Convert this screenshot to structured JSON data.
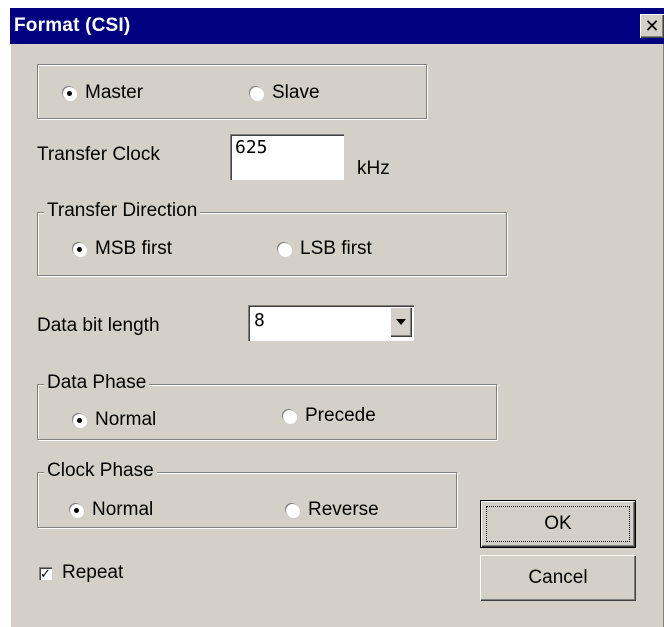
{
  "window": {
    "title": "Format (CSI)",
    "close_glyph": "✕"
  },
  "mode": {
    "master_label": "Master",
    "slave_label": "Slave",
    "selected": "Master"
  },
  "transfer_clock": {
    "label": "Transfer Clock",
    "value": "625",
    "unit": "kHz"
  },
  "transfer_direction": {
    "legend": "Transfer Direction",
    "msb_label": "MSB first",
    "lsb_label": "LSB first",
    "selected": "MSB first"
  },
  "data_bit_length": {
    "label": "Data bit length",
    "value": "8"
  },
  "data_phase": {
    "legend": "Data Phase",
    "normal_label": "Normal",
    "precede_label": "Precede",
    "selected": "Normal"
  },
  "clock_phase": {
    "legend": "Clock Phase",
    "normal_label": "Normal",
    "reverse_label": "Reverse",
    "selected": "Normal"
  },
  "repeat": {
    "label": "Repeat",
    "checked": true,
    "check_glyph": "✓"
  },
  "buttons": {
    "ok_label": "OK",
    "cancel_label": "Cancel"
  },
  "colors": {
    "titlebar": "#000080",
    "dialog_face": "#d4d0c8"
  },
  "icons": {
    "close": "close-icon",
    "dropdown": "chevron-down-icon",
    "check": "check-icon"
  }
}
